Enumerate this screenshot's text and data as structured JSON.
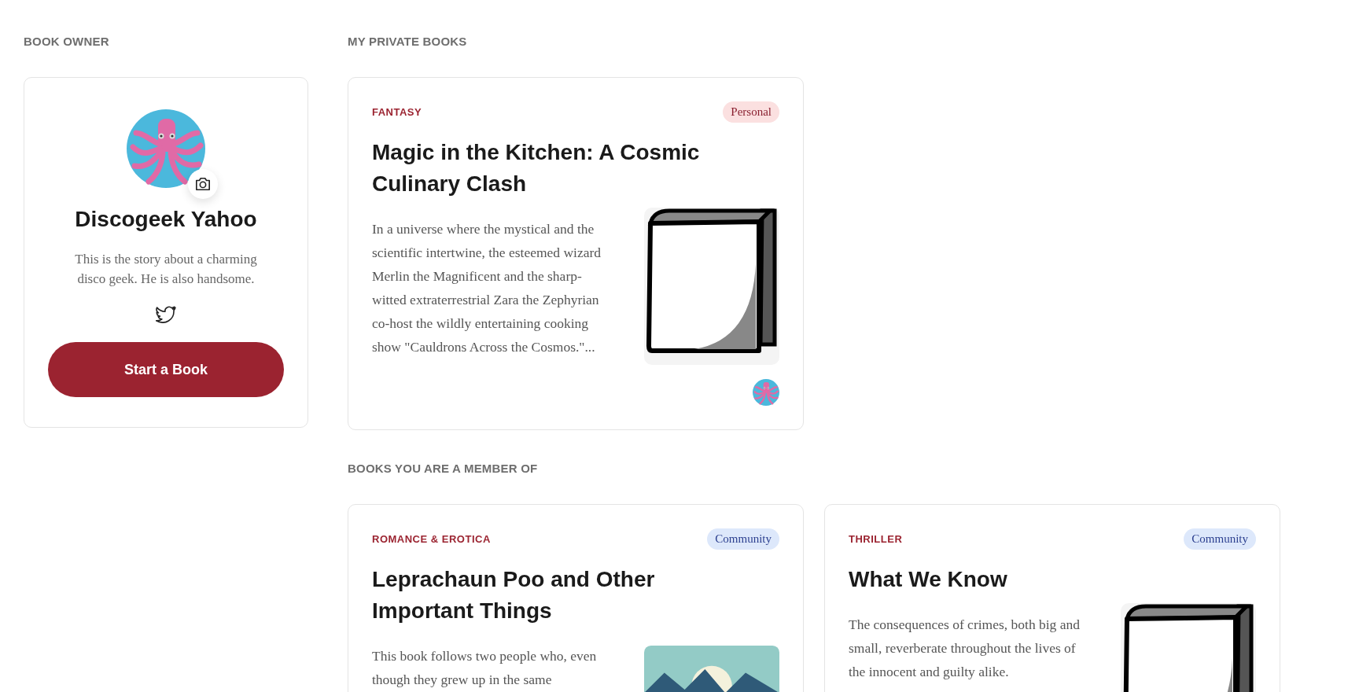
{
  "owner_section": {
    "heading": "BOOK OWNER"
  },
  "owner": {
    "name": "Discogeek Yahoo",
    "bio": "This is the story about a charming disco geek. He is also handsome.",
    "button": "Start a Book"
  },
  "sections": [
    {
      "heading": "MY PRIVATE BOOKS",
      "books": [
        {
          "genre": "FANTASY",
          "badge": {
            "label": "Personal",
            "kind": "personal"
          },
          "title": "Magic in the Kitchen: A Cosmic Culinary Clash",
          "description": "In a universe where the mystical and the scientific intertwine, the esteemed wizard Merlin the Magnificent and the sharp-witted extraterrestrial Zara the Zephyrian co-host the wildly entertaining cooking show \"Cauldrons Across the Cosmos.\"...",
          "kind": "drawn-cover",
          "owner_avatar": true
        }
      ]
    },
    {
      "heading": "BOOKS YOU ARE A MEMBER OF",
      "books": [
        {
          "genre": "ROMANCE & EROTICA",
          "badge": {
            "label": "Community",
            "kind": "community"
          },
          "title": "Leprachaun Poo and Other Important Things",
          "description": "This book follows two people who, even though they grew up in the same",
          "kind": "photo-cover",
          "owner_avatar": false
        },
        {
          "genre": "THRILLER",
          "badge": {
            "label": "Community",
            "kind": "community"
          },
          "title": "What We Know",
          "description": "The consequences of crimes, both big and small, reverberate throughout the lives of the innocent and guilty alike.",
          "kind": "drawn-cover",
          "owner_avatar": false
        }
      ]
    }
  ]
}
